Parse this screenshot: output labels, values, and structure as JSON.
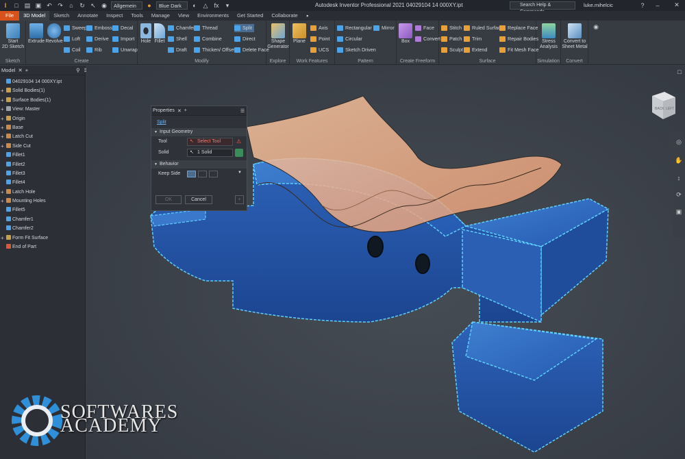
{
  "qat": {
    "material": "Allgemein",
    "appearance": "Blue Dark",
    "title": "Autodesk Inventor Professional 2021    04029104 14 000XY.ipt",
    "help_placeholder": "Search Help & Commands...",
    "user": "luke.mihelcic"
  },
  "tabs": [
    "File",
    "3D Model",
    "Sketch",
    "Annotate",
    "Inspect",
    "Tools",
    "Manage",
    "View",
    "Environments",
    "Get Started",
    "Collaborate"
  ],
  "ribbon": {
    "sketch": {
      "start": "Start\n2D Sketch",
      "label": "Sketch"
    },
    "create": {
      "extrude": "Extrude",
      "revolve": "Revolve",
      "sweep": "Sweep",
      "emboss": "Emboss",
      "decal": "Decal",
      "loft": "Loft",
      "derive": "Derive",
      "import": "Import",
      "coil": "Coil",
      "rib": "Rib",
      "unwrap": "Unwrap",
      "label": "Create"
    },
    "modify": {
      "hole": "Hole",
      "fillet": "Fillet",
      "chamfer": "Chamfer",
      "thread": "Thread",
      "split": "Split",
      "shell": "Shell",
      "combine": "Combine",
      "direct": "Direct",
      "draft": "Draft",
      "thicken": "Thicken/ Offset",
      "delete_face": "Delete Face",
      "label": "Modify"
    },
    "explore": {
      "shape_generator": "Shape\nGenerator",
      "label": "Explore"
    },
    "work_features": {
      "plane": "Plane",
      "axis": "Axis",
      "point": "Point",
      "ucs": "UCS",
      "label": "Work Features"
    },
    "pattern": {
      "rectangular": "Rectangular",
      "mirror": "Mirror",
      "circular": "Circular",
      "sketch_driven": "Sketch Driven",
      "label": "Pattern"
    },
    "freeform": {
      "box": "Box",
      "face": "Face",
      "convert": "Convert",
      "label": "Create Freeform"
    },
    "surface": {
      "stitch": "Stitch",
      "ruled_surface": "Ruled Surface",
      "replace_face": "Replace Face",
      "patch": "Patch",
      "trim": "Trim",
      "repair_bodies": "Repair Bodies",
      "sculpt": "Sculpt",
      "extend": "Extend",
      "fit_mesh_face": "Fit Mesh Face",
      "label": "Surface"
    },
    "simulation": {
      "stress": "Stress\nAnalysis",
      "label": "Simulation"
    },
    "convert": {
      "sheet_metal": "Convert to\nSheet Metal",
      "label": "Convert"
    }
  },
  "browser": {
    "tab": "Model",
    "items": [
      {
        "label": "04029104 14 000XY.ipt",
        "expander": "",
        "color": "#4da3e8"
      },
      {
        "label": "Solid Bodies(1)",
        "expander": "+",
        "color": "#c9a04a"
      },
      {
        "label": "Surface Bodies(1)",
        "expander": "+",
        "color": "#c9a04a"
      },
      {
        "label": "View: Master",
        "expander": "+",
        "color": "#9aa1a9"
      },
      {
        "label": "Origin",
        "expander": "+",
        "color": "#c9a04a"
      },
      {
        "label": "Base",
        "expander": "+",
        "color": "#c98a4a"
      },
      {
        "label": "Latch Cut",
        "expander": "+",
        "color": "#c98a4a"
      },
      {
        "label": "Side Cut",
        "expander": "+",
        "color": "#c98a4a"
      },
      {
        "label": "Fillet1",
        "expander": "",
        "color": "#4da3e8"
      },
      {
        "label": "Fillet2",
        "expander": "",
        "color": "#4da3e8"
      },
      {
        "label": "Fillet3",
        "expander": "",
        "color": "#4da3e8"
      },
      {
        "label": "Fillet4",
        "expander": "",
        "color": "#4da3e8"
      },
      {
        "label": "Latch Hole",
        "expander": "+",
        "color": "#c98a4a"
      },
      {
        "label": "Mounting Holes",
        "expander": "+",
        "color": "#c98a4a"
      },
      {
        "label": "Fillet5",
        "expander": "",
        "color": "#4da3e8"
      },
      {
        "label": "Chamfer1",
        "expander": "",
        "color": "#4da3e8"
      },
      {
        "label": "Chamfer2",
        "expander": "",
        "color": "#4da3e8"
      },
      {
        "label": "Form Fit Surface",
        "expander": "+",
        "color": "#c9a04a"
      },
      {
        "label": "End of Part",
        "expander": "",
        "color": "#d85a3a"
      }
    ]
  },
  "properties": {
    "title": "Properties",
    "command": "Split",
    "input_geometry": "Input Geometry",
    "tool_label": "Tool",
    "tool_value": "Select Tool",
    "solid_label": "Solid",
    "solid_value": "1 Solid",
    "behavior": "Behavior",
    "keep_side": "Keep Side",
    "ok": "OK",
    "cancel": "Cancel"
  },
  "viewcube": {
    "back": "BACK",
    "left": "LEFT"
  },
  "watermark": {
    "line1": "SOFTWARES",
    "line2": "ACADEMY"
  }
}
